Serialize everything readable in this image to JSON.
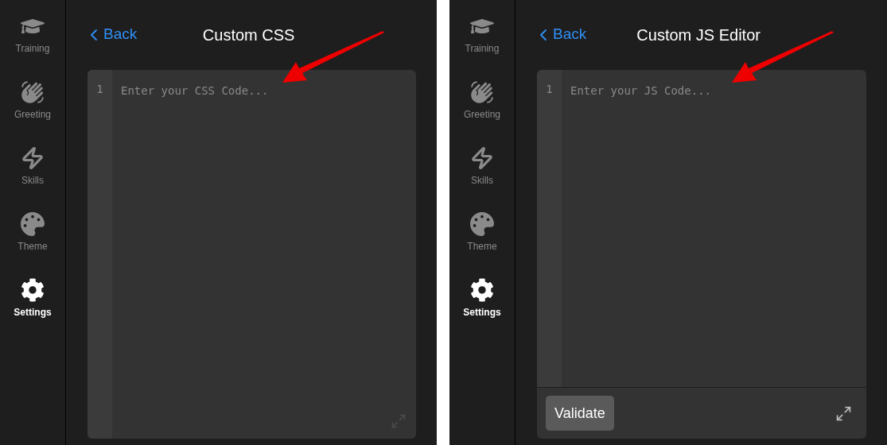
{
  "panels": [
    {
      "sidebar": [
        {
          "label": "Training",
          "selected": false
        },
        {
          "label": "Greeting",
          "selected": false
        },
        {
          "label": "Skills",
          "selected": false
        },
        {
          "label": "Theme",
          "selected": false
        },
        {
          "label": "Settings",
          "selected": true
        }
      ],
      "back": "Back",
      "title": "Custom CSS",
      "editor": {
        "line_number": "1",
        "placeholder": "Enter your CSS Code..."
      }
    },
    {
      "sidebar": [
        {
          "label": "Training",
          "selected": false
        },
        {
          "label": "Greeting",
          "selected": false
        },
        {
          "label": "Skills",
          "selected": false
        },
        {
          "label": "Theme",
          "selected": false
        },
        {
          "label": "Settings",
          "selected": true
        }
      ],
      "back": "Back",
      "title": "Custom JS Editor",
      "editor": {
        "line_number": "1",
        "placeholder": "Enter your JS Code..."
      },
      "validate_button": "Validate"
    }
  ]
}
